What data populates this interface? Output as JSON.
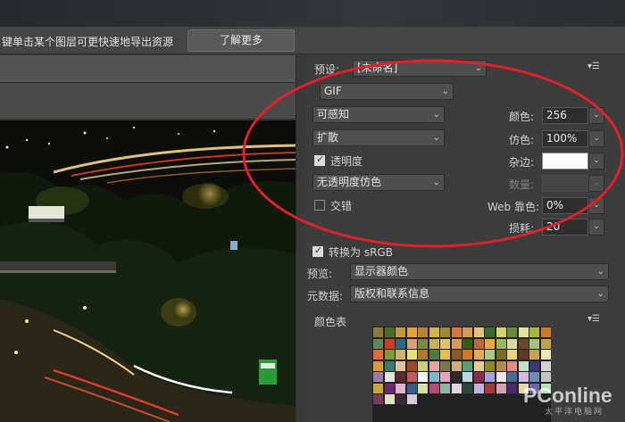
{
  "info_bar": {
    "text": "键单击某个图层可更快速地导出资源",
    "learn_more": "了解更多"
  },
  "preset": {
    "label": "预设:",
    "value": "[未命名]"
  },
  "format": {
    "value": "GIF"
  },
  "reduction": {
    "value": "可感知"
  },
  "dither_algo": {
    "value": "扩散"
  },
  "transparency": {
    "label": "透明度",
    "checked": true
  },
  "transparency_dither": {
    "value": "无透明度仿色"
  },
  "interlaced": {
    "label": "交错",
    "checked": false
  },
  "colors": {
    "label": "颜色:",
    "value": "256"
  },
  "dither": {
    "label": "仿色:",
    "value": "100%"
  },
  "matte": {
    "label": "杂边:"
  },
  "amount": {
    "label": "数量:"
  },
  "web_snap": {
    "label": "Web 靠色:",
    "value": "0%"
  },
  "lossy": {
    "label": "损耗:",
    "value": "20"
  },
  "convert_srgb": {
    "label": "转换为 sRGB",
    "checked": true
  },
  "preview": {
    "label": "预览:",
    "value": "显示器颜色"
  },
  "metadata": {
    "label": "元数据:",
    "value": "版权和联系信息"
  },
  "color_table": {
    "label": "颜色表"
  },
  "watermark": {
    "brand": "PConline",
    "sub": "太平洋电脑网"
  },
  "colors_map": {
    "panel": "#3d3d3d",
    "annotation": "#e0202a"
  },
  "swatches": [
    "#8a7a3a",
    "#4f6b2a",
    "#c49a36",
    "#e2a23a",
    "#b8862a",
    "#d6b04a",
    "#a08a2e",
    "#d6773c",
    "#cf9a5a",
    "#e8c07a",
    "#3a6a2a",
    "#d8d26a",
    "#6a8a3a",
    "#e2e2a2",
    "#a8b83a",
    "#cc7a2a",
    "#5a8a5a",
    "#d23a2a",
    "#2a6a7a",
    "#d8a07a",
    "#7a8a3a",
    "#c7b05a",
    "#e2c276",
    "#d89a5a",
    "#3a5a1a",
    "#b86a3a",
    "#e8a84a",
    "#9ab85a",
    "#d8d8a0",
    "#6a4a2a",
    "#a2c27a",
    "#c2a24a",
    "#e86a3a",
    "#7a9a3a",
    "#d2b26a",
    "#e2e27a",
    "#b6762a",
    "#4a7a4a",
    "#e8be4a",
    "#8a5a2a",
    "#d2762a",
    "#e2aa5a",
    "#a8c890",
    "#7a6a2a",
    "#e8d27a",
    "#5a3a2a",
    "#c7a25a",
    "#e8e8b8",
    "#d89a3a",
    "#3a7a6a",
    "#e2c2a2",
    "#9a4a2a",
    "#c2d27a",
    "#e8a2a2",
    "#7a7a4a",
    "#d0b080",
    "#5a9a7a",
    "#e6cc92",
    "#8a8a2a",
    "#b28a5a",
    "#e28a8a",
    "#c2e2c2",
    "#3a3a7a",
    "#d2d2d2",
    "#9a7aa2",
    "#e2e2e2",
    "#5a2a2a",
    "#c25a5a",
    "#ffffff",
    "#7ab8c8",
    "#e2a2c2",
    "#2a2a2a",
    "#b8d8e8",
    "#8a2a4a",
    "#a2a2e2",
    "#e8e8e8",
    "#4a6a9a",
    "#d8b8e8",
    "#6a8ab8",
    "#c2c2c2",
    "#c8a83a",
    "#6a2a6a",
    "#e2b2d2",
    "#3a5a8a",
    "#d2e2a2",
    "#b84a7a",
    "#8ab8a2",
    "#e2d2e2",
    "#2a4a3a",
    "#c2b2e2",
    "#a23a3a",
    "#d2a2b2",
    "#4a2a6a",
    "#e8d8a8",
    "#6a6aa2",
    "#b8e2b8",
    "#7a3a5a",
    "#e2e2c2",
    "#3a2a3a",
    "#d8c8d8"
  ]
}
